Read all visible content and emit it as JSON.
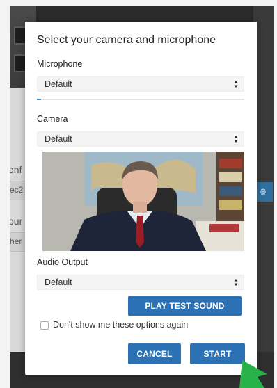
{
  "dialog": {
    "title": "Select your camera and microphone",
    "microphone": {
      "label": "Microphone",
      "value": "Default",
      "level": 0.02
    },
    "camera": {
      "label": "Camera",
      "value": "Default"
    },
    "audio_output": {
      "label": "Audio Output",
      "value": "Default"
    },
    "play_test_sound": "PLAY TEST SOUND",
    "dont_show_again": "Don't show me these options again",
    "cancel": "CANCEL",
    "start": "START"
  },
  "background": {
    "partial_text_1": "onf",
    "partial_text_2": "ec2",
    "partial_text_3": "our",
    "partial_text_4": "her"
  },
  "colors": {
    "accent": "#2c71b3",
    "pointer": "#27b24a",
    "meter": "#3f8fd0"
  },
  "icons": {
    "select_arrows": "up-down-arrows-icon",
    "pointer": "green-arrow-pointer",
    "chip": "gear-icon"
  }
}
